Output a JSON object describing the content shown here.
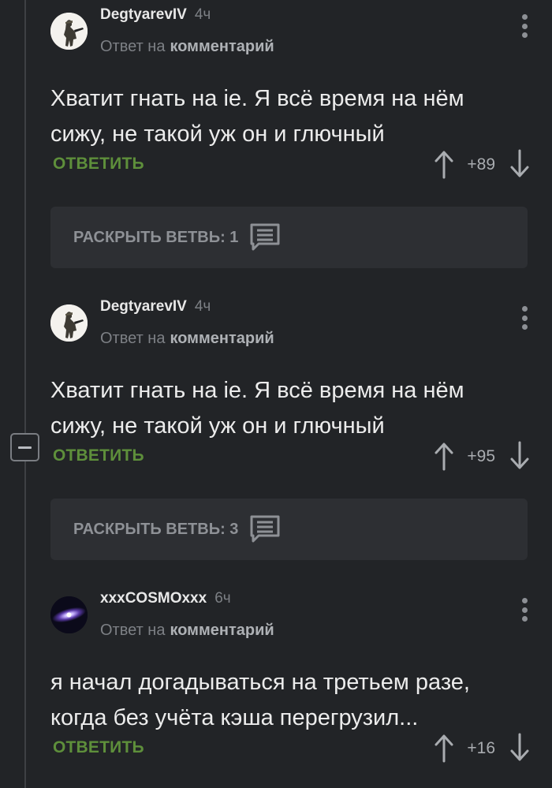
{
  "colors": {
    "background": "#222427",
    "accent_reply": "#5e8f3b",
    "muted": "#7d8085",
    "expand_box": "#2d2f33"
  },
  "comments": [
    {
      "author": "DegtyarevIV",
      "time": "4ч",
      "reply_prefix": "Ответ на",
      "reply_target": "комментарий",
      "text_lines": [
        "Хватит гнать на ie. Я всё время на нём",
        "сижу, не такой уж он и глючный"
      ],
      "reply_label": "ОТВЕТИТЬ",
      "score": "+89",
      "avatar_icon": "soldier-avatar"
    },
    {
      "author": "DegtyarevIV",
      "time": "4ч",
      "reply_prefix": "Ответ на",
      "reply_target": "комментарий",
      "text_lines": [
        "Хватит гнать на ie. Я всё время на нём",
        "сижу, не такой уж он и глючный"
      ],
      "reply_label": "ОТВЕТИТЬ",
      "score": "+95",
      "avatar_icon": "soldier-avatar"
    },
    {
      "author": "xxxCOSMOxxx",
      "time": "6ч",
      "reply_prefix": "Ответ на",
      "reply_target": "комментарий",
      "text_lines": [
        "я начал догадываться на третьем разе,",
        "когда без учёта кэша перегрузил..."
      ],
      "reply_label": "ОТВЕТИТЬ",
      "score": "+16",
      "avatar_icon": "galaxy-avatar"
    }
  ],
  "expand_branches": [
    {
      "label": "РАСКРЫТЬ ВЕТВЬ: 1"
    },
    {
      "label": "РАСКРЫТЬ ВЕТВЬ: 3"
    }
  ],
  "icons": {
    "vote_up": "arrow-up-icon",
    "vote_down": "arrow-down-icon",
    "more": "more-vertical-icon",
    "expand": "comments-icon",
    "collapse": "minus-icon"
  }
}
